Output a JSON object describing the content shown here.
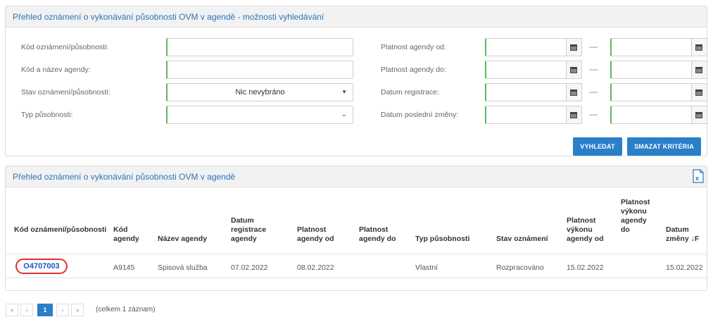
{
  "search": {
    "title": "Přehled oznámení o vykonávání působnosti OVM v agendě - možnosti vyhledávání",
    "labels": {
      "kod": "Kód oznámení/působnosti:",
      "agenda": "Kód a název agendy:",
      "stav": "Stav oznámení/působnosti:",
      "typ": "Typ působnosti:",
      "platnost_od": "Platnost agendy od:",
      "platnost_do": "Platnost agendy do:",
      "registrace": "Datum registrace:",
      "zmena": "Datum poslední změny:"
    },
    "stav_value": "Nic nevybráno",
    "range_separator": "—",
    "buttons": {
      "search": "VYHLEDAT",
      "clear": "SMAZAT KRITÉRIA"
    }
  },
  "results": {
    "title": "Přehled oznámení o vykonávání působnosti OVM v agendě",
    "export_icon": "excel-export-icon",
    "columns": [
      "Kód oznámení/působnosti",
      "Kód agendy",
      "Název agendy",
      "Datum registrace agendy",
      "Platnost agendy od",
      "Platnost agendy do",
      "Typ působnosti",
      "Stav oznámení",
      "Platnost výkonu agendy od",
      "Platnost výkonu agendy do",
      "Datum změny"
    ],
    "sort_icon": "↓F",
    "rows": [
      {
        "kod": "O4707003",
        "kod_agendy": "A9145",
        "nazev": "Spisová služba",
        "registrace": "07.02.2022",
        "platnost_od": "08.02.2022",
        "platnost_do": "",
        "typ": "Vlastní",
        "stav": "Rozpracováno",
        "vykon_od": "15.02.2022",
        "vykon_do": "",
        "zmena": "15.02.2022"
      }
    ]
  },
  "pagination": {
    "first": "«",
    "prev": "‹",
    "current": "1",
    "next": "›",
    "last": "»",
    "info": "(celkem 1 záznam)"
  },
  "colors": {
    "accent": "#2a7fc9",
    "valid": "#5cb85c",
    "highlight": "#e03030"
  }
}
